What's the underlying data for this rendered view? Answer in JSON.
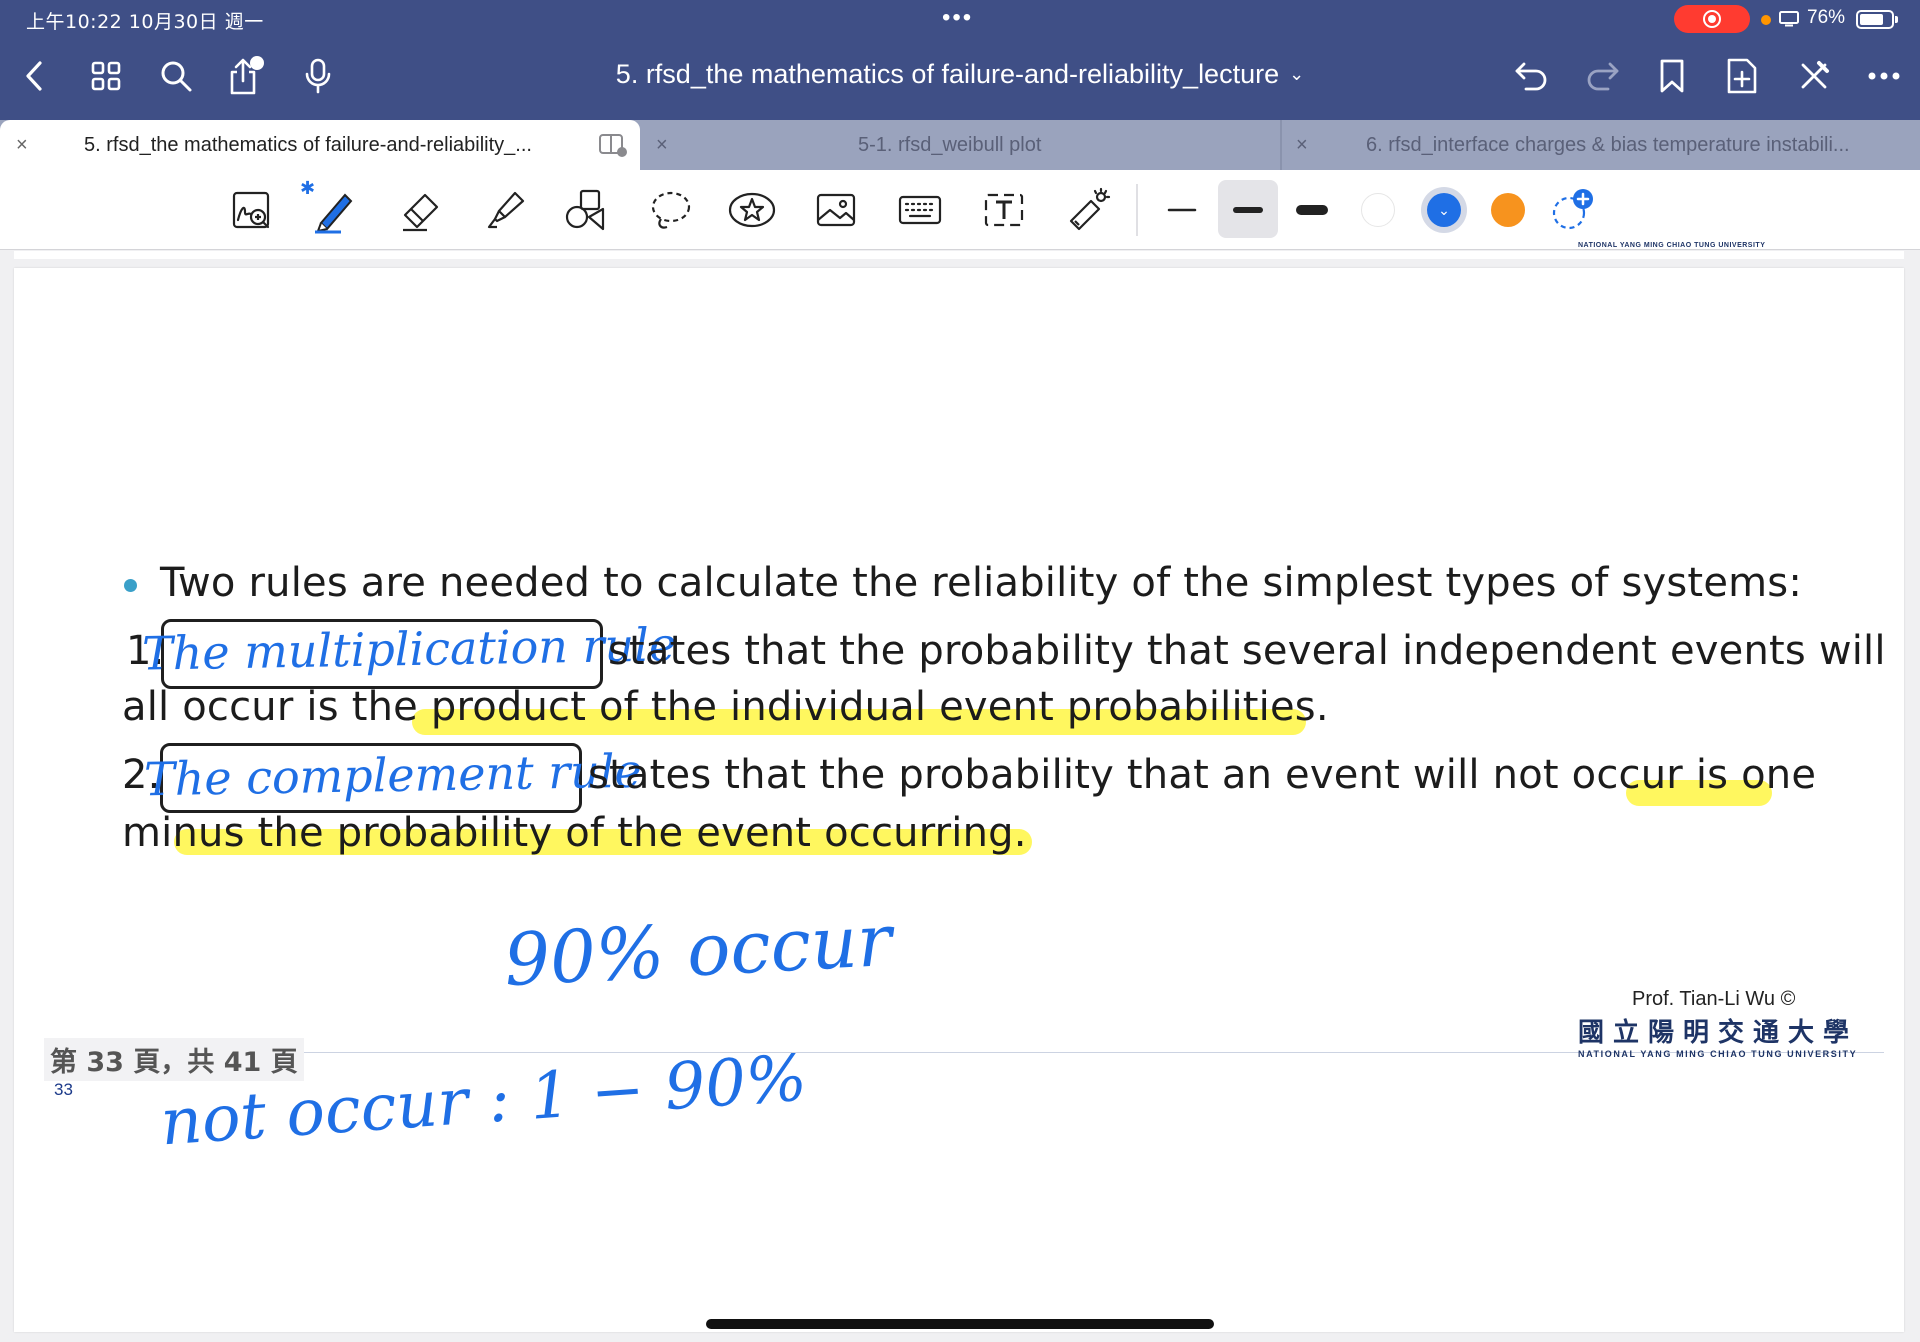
{
  "status_bar": {
    "time": "上午10:22   10月30日 週一",
    "dots": "•••",
    "battery_pct": "76%",
    "battery_level": 0.76,
    "record_color": "#ff3b30",
    "mic_dot_color": "#ff9500"
  },
  "nav": {
    "title": "5. rfsd_the mathematics of failure-and-reliability_lecture",
    "title_chevron": "⌄",
    "left_icons": [
      "back-icon",
      "grid-icon",
      "search-icon",
      "share-icon",
      "microphone-icon"
    ],
    "right_icons": [
      "undo-icon",
      "redo-icon",
      "bookmark-icon",
      "add-page-icon",
      "close-edit-icon",
      "more-icon"
    ]
  },
  "tabs": [
    {
      "label": "5. rfsd_the mathematics of failure-and-reliability_...",
      "close": "×",
      "active": true
    },
    {
      "label": "5-1. rfsd_weibull plot",
      "close": "×",
      "active": false
    },
    {
      "label": "6. rfsd_interface charges & bias temperature instabili...",
      "close": "×",
      "active": false
    }
  ],
  "toolbar": {
    "tools": [
      "zoom-write-icon",
      "pen-icon",
      "eraser-icon",
      "highlighter-icon",
      "shapes-icon",
      "lasso-icon",
      "sticker-icon",
      "image-icon",
      "keyboard-icon",
      "text-box-icon",
      "laser-pointer-icon"
    ],
    "bluetooth": "✱",
    "colors": {
      "white": "#ffffff",
      "blue": "#1f6fe5",
      "orange": "#f7931e"
    },
    "add_color": "+"
  },
  "slide": {
    "bullet_text": "Two rules are needed to calculate the reliability of the simplest types of systems:",
    "rule1_num": "1.",
    "rule1_line1": "states that the probability that several independent events will",
    "rule1_line2": "all occur is the product of the individual event probabilities.",
    "rule2_num": "2.",
    "rule2_line1": "states that the probability that an event will not occur is one",
    "rule2_line2": "minus the probability of the event occurring.",
    "bullet_color": "#3aa0c9",
    "highlight_color": "#fff532"
  },
  "handwriting": {
    "rule1_name": "The multiplication rule",
    "rule2_name": "The complement rule",
    "note1": "90% occur",
    "note2": "not occur :  1 − 90%",
    "ink_color": "#1f6fe5"
  },
  "footer": {
    "page_indicator": "第 33 頁，共 41 頁",
    "slide_number": "33",
    "professor": "Prof. Tian-Li Wu ©",
    "university_cn": "國立陽明交通大學",
    "university_en": "NATIONAL YANG MING CHIAO TUNG UNIVERSITY"
  }
}
